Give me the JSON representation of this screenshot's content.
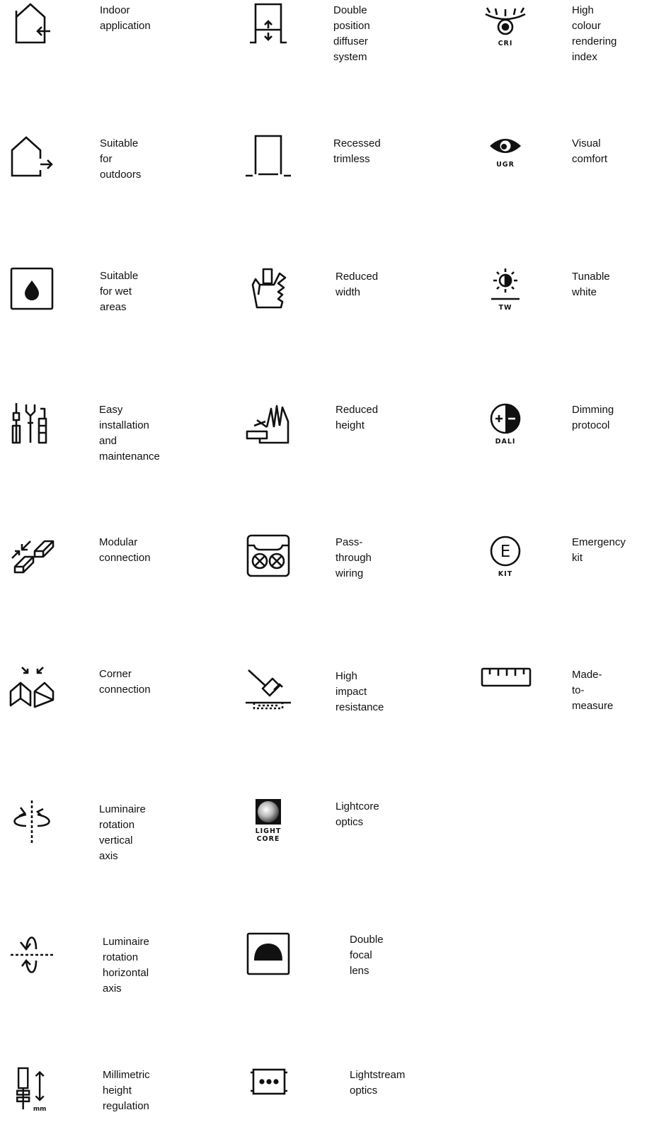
{
  "features": {
    "indoor_application": "Indoor application",
    "double_position_diffuser": [
      "Double position",
      "diffuser system"
    ],
    "high_cri": [
      "High colour",
      "rendering index"
    ],
    "cri_tag": "CRI",
    "suitable_outdoors": "Suitable for outdoors",
    "recessed_trimless": "Recessed trimless",
    "visual_comfort": "Visual comfort",
    "ugr_tag": "UGR",
    "wet_areas": [
      "Suitable for wet",
      "areas"
    ],
    "reduced_width": "Reduced width",
    "tunable_white": "Tunable white",
    "tw_tag": "TW",
    "easy_installation": [
      "Easy installation",
      "and maintenance"
    ],
    "reduced_height": "Reduced height",
    "dimming_protocol": "Dimming protocol",
    "dali_tag": "DALI",
    "modular_connection": "Modular connection",
    "pass_through_wiring": "Pass-through wiring",
    "emergency_kit": "Emergency kit",
    "emergency_letter": "E",
    "kit_tag": "KIT",
    "corner_connection": "Corner connection",
    "high_impact": [
      "High impact",
      "resistance"
    ],
    "made_to_measure": "Made-to-measure",
    "rotation_vertical": [
      "Luminaire rotation",
      "vertical axis"
    ],
    "lightcore_optics": "Lightcore optics",
    "lightcore_tag": [
      "LIGHT",
      "CORE"
    ],
    "rotation_horizontal": [
      "Luminaire rotation",
      "horizontal axis"
    ],
    "double_focal_lens": "Double focal lens",
    "millimetric_height": [
      "Millimetric height",
      "regulation"
    ],
    "mm_tag": "mm",
    "lightstream_optics": "Lightstream optics"
  },
  "colors": {
    "ink": "#111111",
    "background": "#ffffff"
  }
}
